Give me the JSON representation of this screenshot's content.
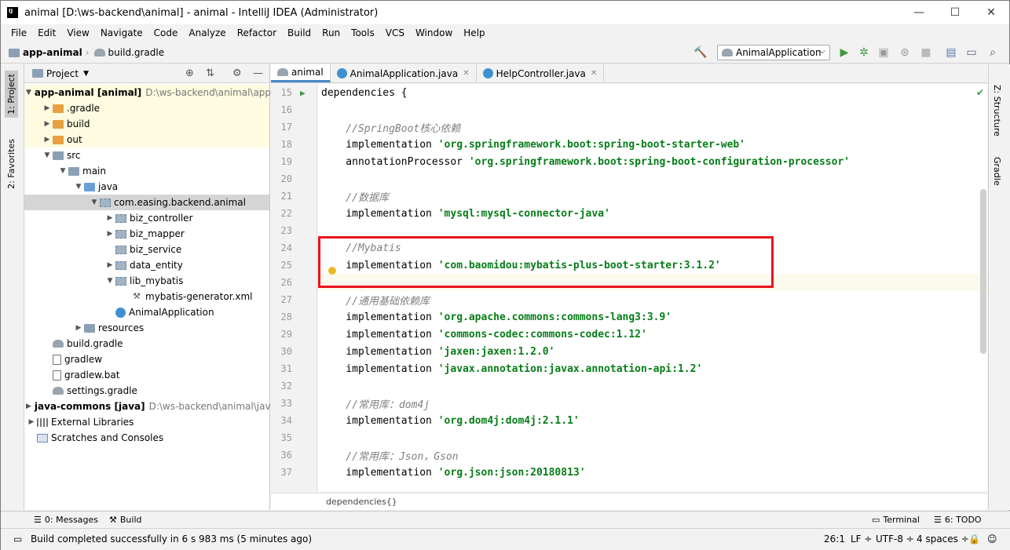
{
  "window": {
    "title": "animal [D:\\ws-backend\\animal] - animal - IntelliJ IDEA (Administrator)",
    "minimize": "—",
    "maximize": "☐",
    "close": "✕"
  },
  "menu": [
    "File",
    "Edit",
    "View",
    "Navigate",
    "Code",
    "Analyze",
    "Refactor",
    "Build",
    "Run",
    "Tools",
    "VCS",
    "Window",
    "Help"
  ],
  "navbar": {
    "crumb1": "app-animal",
    "crumb2": "build.gradle",
    "run_config": "AnimalApplication"
  },
  "left_tabs": {
    "project": "1: Project",
    "favorites": "2: Favorites"
  },
  "right_tabs": {
    "structure": "Z: Structure",
    "gradle": "Gradle"
  },
  "project_panel": {
    "title": "Project",
    "tree": [
      {
        "label": "app-animal [animal]",
        "path": "D:\\ws-backend\\animal\\app-an",
        "depth": 0,
        "arrow": "▼",
        "icon": "folder"
      },
      {
        "label": ".gradle",
        "depth": 1,
        "arrow": "▶",
        "icon": "orange"
      },
      {
        "label": "build",
        "depth": 1,
        "arrow": "▶",
        "icon": "orange"
      },
      {
        "label": "out",
        "depth": 1,
        "arrow": "▶",
        "icon": "orange"
      },
      {
        "label": "src",
        "depth": 1,
        "arrow": "▼",
        "icon": "folder"
      },
      {
        "label": "main",
        "depth": 2,
        "arrow": "▼",
        "icon": "folder"
      },
      {
        "label": "java",
        "depth": 3,
        "arrow": "▼",
        "icon": "blue"
      },
      {
        "label": "com.easing.backend.animal",
        "depth": 4,
        "arrow": "▼",
        "icon": "pkg"
      },
      {
        "label": "biz_controller",
        "depth": 5,
        "arrow": "▶",
        "icon": "pkg"
      },
      {
        "label": "biz_mapper",
        "depth": 5,
        "arrow": "▶",
        "icon": "pkg"
      },
      {
        "label": "biz_service",
        "depth": 5,
        "arrow": "",
        "icon": "pkg"
      },
      {
        "label": "data_entity",
        "depth": 5,
        "arrow": "▶",
        "icon": "pkg"
      },
      {
        "label": "lib_mybatis",
        "depth": 5,
        "arrow": "▼",
        "icon": "pkg"
      },
      {
        "label": "mybatis-generator.xml",
        "depth": 6,
        "arrow": "",
        "icon": "xml"
      },
      {
        "label": "AnimalApplication",
        "depth": 5,
        "arrow": "",
        "icon": "class"
      },
      {
        "label": "resources",
        "depth": 3,
        "arrow": "▶",
        "icon": "folder"
      },
      {
        "label": "build.gradle",
        "depth": 1,
        "arrow": "",
        "icon": "gradle"
      },
      {
        "label": "gradlew",
        "depth": 1,
        "arrow": "",
        "icon": "file"
      },
      {
        "label": "gradlew.bat",
        "depth": 1,
        "arrow": "",
        "icon": "file"
      },
      {
        "label": "settings.gradle",
        "depth": 1,
        "arrow": "",
        "icon": "gradle"
      },
      {
        "label": "java-commons [java]",
        "path": "D:\\ws-backend\\animal\\java-c",
        "depth": 0,
        "arrow": "▶",
        "icon": "folder"
      },
      {
        "label": "External Libraries",
        "depth": 0,
        "arrow": "▶",
        "icon": "lib"
      },
      {
        "label": "Scratches and Consoles",
        "depth": 0,
        "arrow": "",
        "icon": "scratch"
      }
    ]
  },
  "editor": {
    "tabs": [
      {
        "label": "animal",
        "active": true
      },
      {
        "label": "AnimalApplication.java",
        "active": false
      },
      {
        "label": "HelpController.java",
        "active": false
      }
    ],
    "lines": [
      {
        "n": "15",
        "parts": [
          {
            "t": "dependencies {",
            "c": "kw"
          }
        ]
      },
      {
        "n": "16",
        "parts": []
      },
      {
        "n": "17",
        "parts": [
          {
            "t": "    //SpringBoot核心依赖",
            "c": "cm"
          }
        ]
      },
      {
        "n": "18",
        "parts": [
          {
            "t": "    implementation ",
            "c": "kw"
          },
          {
            "t": "'org.springframework.boot:spring-boot-starter-web'",
            "c": "str"
          }
        ]
      },
      {
        "n": "19",
        "parts": [
          {
            "t": "    annotationProcessor ",
            "c": "kw"
          },
          {
            "t": "'org.springframework.boot:spring-boot-configuration-processor'",
            "c": "str"
          }
        ]
      },
      {
        "n": "20",
        "parts": []
      },
      {
        "n": "21",
        "parts": [
          {
            "t": "    //数据库",
            "c": "cm"
          }
        ]
      },
      {
        "n": "22",
        "parts": [
          {
            "t": "    implementation ",
            "c": "kw"
          },
          {
            "t": "'mysql:mysql-connector-java'",
            "c": "str"
          }
        ]
      },
      {
        "n": "23",
        "parts": []
      },
      {
        "n": "24",
        "parts": [
          {
            "t": "    //Mybatis",
            "c": "cm"
          }
        ]
      },
      {
        "n": "25",
        "parts": [
          {
            "t": "    implementation ",
            "c": "kw"
          },
          {
            "t": "'com.baomidou:mybatis-plus-boot-starter:3.1.2'",
            "c": "str"
          }
        ]
      },
      {
        "n": "26",
        "parts": [],
        "caret": true
      },
      {
        "n": "27",
        "parts": [
          {
            "t": "    //通用基础依赖库",
            "c": "cm"
          }
        ]
      },
      {
        "n": "28",
        "parts": [
          {
            "t": "    implementation ",
            "c": "kw"
          },
          {
            "t": "'org.apache.commons:commons-lang3:3.9'",
            "c": "str"
          }
        ]
      },
      {
        "n": "29",
        "parts": [
          {
            "t": "    implementation ",
            "c": "kw"
          },
          {
            "t": "'commons-codec:commons-codec:1.12'",
            "c": "str"
          }
        ]
      },
      {
        "n": "30",
        "parts": [
          {
            "t": "    implementation ",
            "c": "kw"
          },
          {
            "t": "'jaxen:jaxen:1.2.0'",
            "c": "str"
          }
        ]
      },
      {
        "n": "31",
        "parts": [
          {
            "t": "    implementation ",
            "c": "kw"
          },
          {
            "t": "'javax.annotation:javax.annotation-api:1.2'",
            "c": "str"
          }
        ]
      },
      {
        "n": "32",
        "parts": []
      },
      {
        "n": "33",
        "parts": [
          {
            "t": "    //常用库：dom4j",
            "c": "cm"
          }
        ]
      },
      {
        "n": "34",
        "parts": [
          {
            "t": "    implementation ",
            "c": "kw"
          },
          {
            "t": "'org.dom4j:dom4j:2.1.1'",
            "c": "str"
          }
        ]
      },
      {
        "n": "35",
        "parts": []
      },
      {
        "n": "36",
        "parts": [
          {
            "t": "    //常用库：Json，Gson",
            "c": "cm"
          }
        ]
      },
      {
        "n": "37",
        "parts": [
          {
            "t": "    implementation ",
            "c": "kw"
          },
          {
            "t": "'org.json:json:20180813'",
            "c": "str"
          }
        ]
      }
    ],
    "breadcrumb": "dependencies{}"
  },
  "bottom_tools": {
    "messages": "0: Messages",
    "build": "Build",
    "terminal": "Terminal",
    "todo": "6: TODO"
  },
  "status": {
    "message": "Build completed successfully in 6 s 983 ms (5 minutes ago)",
    "position": "26:1",
    "line_sep": "LF ÷",
    "encoding": "UTF-8 ÷",
    "indent": "4 spaces ÷"
  }
}
